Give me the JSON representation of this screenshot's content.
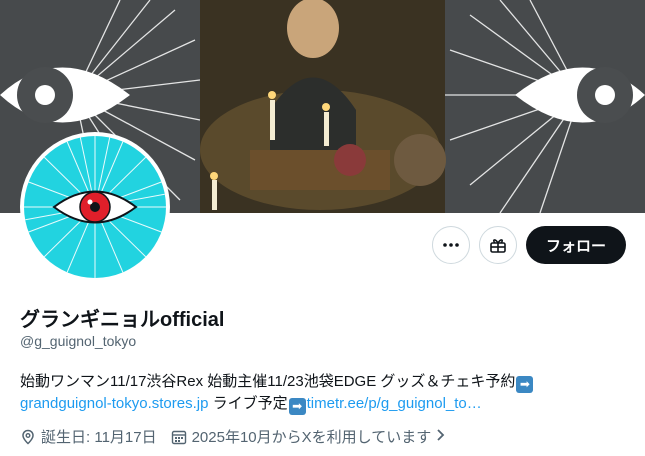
{
  "profile": {
    "name": "グランギニョルofficial",
    "handle": "@g_guignol_tokyo",
    "bio_line1": "始動ワンマン11/17渋谷Rex 始動主催11/23池袋EDGE グッズ＆チェキ予約",
    "bio_link1": "grandguignol-tokyo.stores.jp",
    "bio_text2": "ライブ予定",
    "bio_link2": "timetr.ee/p/g_guignol_to…",
    "birthday": "誕生日: 11月17日",
    "joined": "2025年10月からXを利用しています"
  },
  "actions": {
    "follow_label": "フォロー"
  },
  "colors": {
    "accent": "#1d9bf0",
    "follow_bg": "#0f1419",
    "avatar_bg": "#22d3e0",
    "eye_red": "#e01f2a"
  },
  "icons": [
    "more-icon",
    "gift-icon",
    "arrow-right-emoji",
    "location-pin-icon",
    "calendar-icon",
    "chevron-right-icon",
    "eye-icon"
  ]
}
